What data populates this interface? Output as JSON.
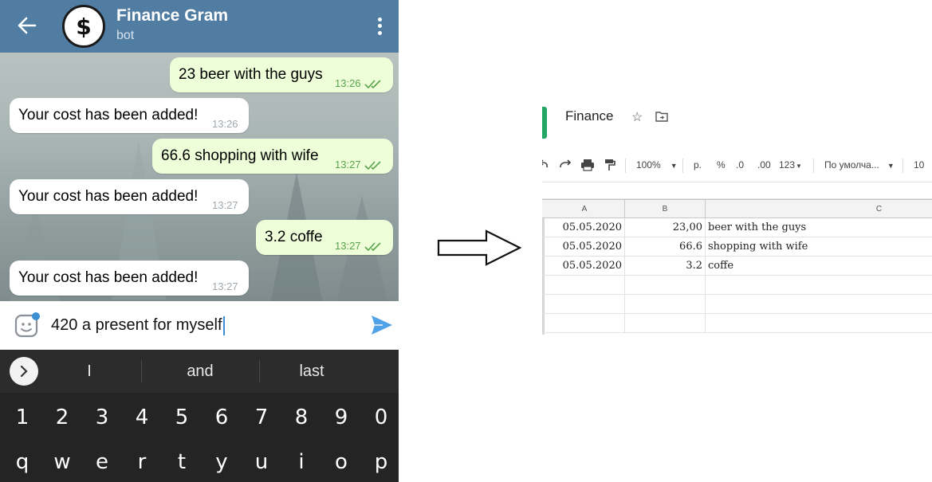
{
  "telegram": {
    "chat_title": "Finance Gram",
    "chat_subtitle": "bot",
    "avatar_symbol": "$",
    "messages": [
      {
        "direction": "out",
        "text": "23 beer with the guys",
        "time": "13:26",
        "status": "read"
      },
      {
        "direction": "in",
        "text": "Your cost has been added!",
        "time": "13:26"
      },
      {
        "direction": "out",
        "text": "66.6 shopping with wife",
        "time": "13:27",
        "status": "read"
      },
      {
        "direction": "in",
        "text": "Your cost has been added!",
        "time": "13:27"
      },
      {
        "direction": "out",
        "text": "3.2 coffe",
        "time": "13:27",
        "status": "read"
      },
      {
        "direction": "in",
        "text": "Your cost has been added!",
        "time": "13:27"
      }
    ],
    "input_value": "420 a present for myself",
    "colors": {
      "header": "#527da3",
      "outgoing_bubble": "#eefed8",
      "send": "#50a2e6"
    }
  },
  "keyboard": {
    "suggestions": [
      "I",
      "and",
      "last"
    ],
    "number_row": [
      "1",
      "2",
      "3",
      "4",
      "5",
      "6",
      "7",
      "8",
      "9",
      "0"
    ],
    "letter_row": [
      "q",
      "w",
      "e",
      "r",
      "t",
      "y",
      "u",
      "i",
      "o",
      "p"
    ]
  },
  "sheets": {
    "title": "Finance",
    "toolbar": {
      "zoom": "100%",
      "currency": "р.",
      "percent": "%",
      "decrease_decimals": ".0",
      "increase_decimals": ".00",
      "number_format": "123",
      "font": "По умолча...",
      "font_size": "10"
    },
    "column_headers": [
      "A",
      "B",
      "C"
    ],
    "rows": [
      {
        "a": "05.05.2020",
        "b": "23,00",
        "c": "beer with the guys"
      },
      {
        "a": "05.05.2020",
        "b": "66.6",
        "c": "shopping with wife"
      },
      {
        "a": "05.05.2020",
        "b": "3.2",
        "c": "coffe"
      }
    ],
    "colors": {
      "logo": "#23a566"
    }
  }
}
